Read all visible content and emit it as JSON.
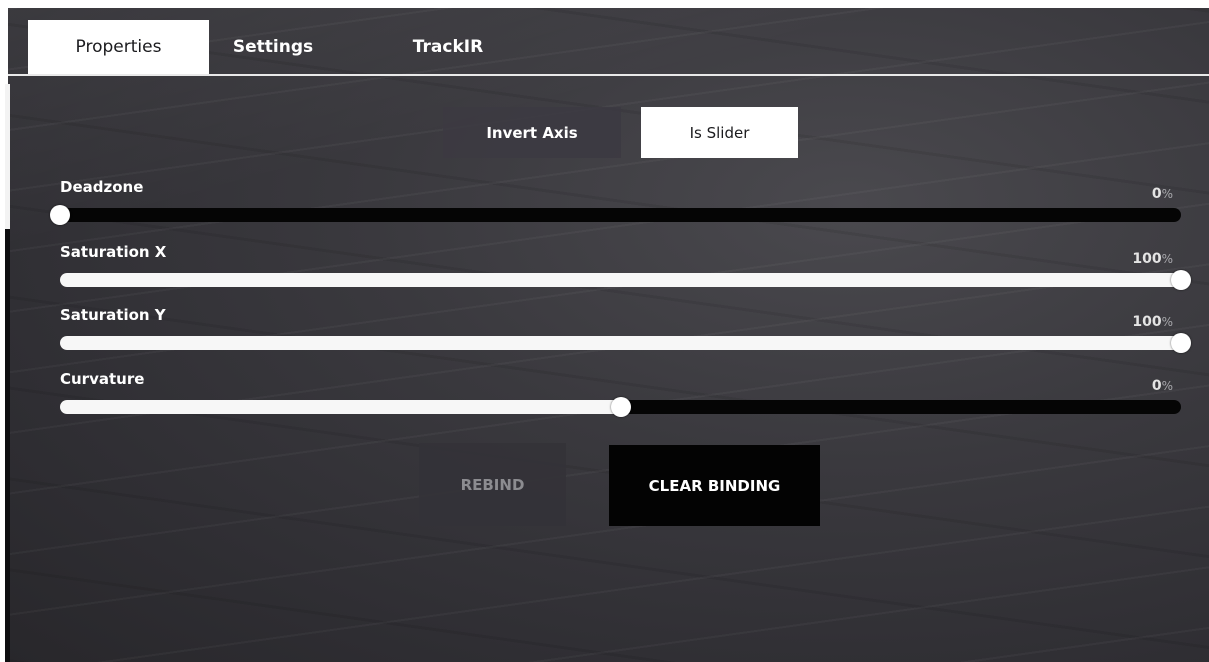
{
  "tabs": [
    {
      "label": "Properties",
      "active": true
    },
    {
      "label": "Settings",
      "active": false
    },
    {
      "label": "TrackIR",
      "active": false
    }
  ],
  "toggles": {
    "invert_axis": {
      "label": "Invert Axis",
      "selected": false
    },
    "is_slider": {
      "label": "Is Slider",
      "selected": true
    }
  },
  "sliders": [
    {
      "label": "Deadzone",
      "value": "0",
      "unit": "%",
      "fraction": 0.0
    },
    {
      "label": "Saturation X",
      "value": "100",
      "unit": "%",
      "fraction": 1.0
    },
    {
      "label": "Saturation Y",
      "value": "100",
      "unit": "%",
      "fraction": 1.0
    },
    {
      "label": "Curvature",
      "value": "0",
      "unit": "%",
      "fraction": 0.5
    }
  ],
  "actions": {
    "rebind_label": "REBIND",
    "clear_binding_label": "CLEAR BINDING"
  },
  "colors": {
    "panel_background": "#3a393e",
    "active_tab": "#ffffff",
    "track": "#050505",
    "fill": "#f7f7f7",
    "clear_button": "#030303",
    "rebind_button": "#343338"
  }
}
